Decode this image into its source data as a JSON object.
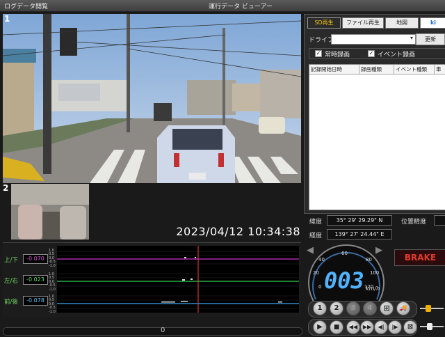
{
  "window": {
    "menu_label": "ログデータ閲覧",
    "title": "運行データ ビューアー"
  },
  "video": {
    "main_camera_number": "1",
    "sub_camera_number": "2",
    "timestamp": "2023/04/12 10:34:38"
  },
  "tabs": [
    {
      "label": "SD再生",
      "active": true
    },
    {
      "label": "ファイル再生",
      "active": false
    },
    {
      "label": "地図",
      "active": false
    },
    {
      "label": "ki",
      "active": false
    }
  ],
  "drive": {
    "label": "ドライブ:",
    "value": "",
    "update_label": "更新"
  },
  "filters": [
    {
      "label": "常時録画",
      "checked": true
    },
    {
      "label": "イベント録画",
      "checked": true
    }
  ],
  "record_table": {
    "columns": [
      "記録開始日時",
      "録画種類",
      "イベント種類",
      "車"
    ],
    "rows": []
  },
  "gps": {
    "lat_label": "緯度",
    "lat_value": "35° 29' 29.29\" N",
    "lon_label": "経度",
    "lon_value": "139° 27' 24.44\" E",
    "accuracy_label": "位置精度",
    "accuracy_value": ""
  },
  "sensors": [
    {
      "label": "上/下",
      "value": "-0.070",
      "color": "#cc33cc"
    },
    {
      "label": "左/右",
      "value": "-0.023",
      "color": "#33cc55"
    },
    {
      "label": "前/後",
      "value": "-0.078",
      "color": "#33aaee"
    }
  ],
  "sensor_ticks": [
    "1.0",
    "0.5",
    "0.0",
    "-0.5",
    "-1.0"
  ],
  "speed": {
    "value": "003",
    "unit": "km/h",
    "dial_ticks": [
      "0",
      "20",
      "40",
      "60",
      "80",
      "100",
      "120"
    ],
    "max": 120
  },
  "brake_label": "BRAKE",
  "camera_buttons": [
    "1",
    "2",
    "3",
    "4"
  ],
  "scroll_indicator": "0",
  "colors": {
    "accent_tab": "#f1c40f",
    "speed_digits": "#4fb3ff",
    "brake": "#e23a2a",
    "playhead": "#ff3b3b"
  }
}
